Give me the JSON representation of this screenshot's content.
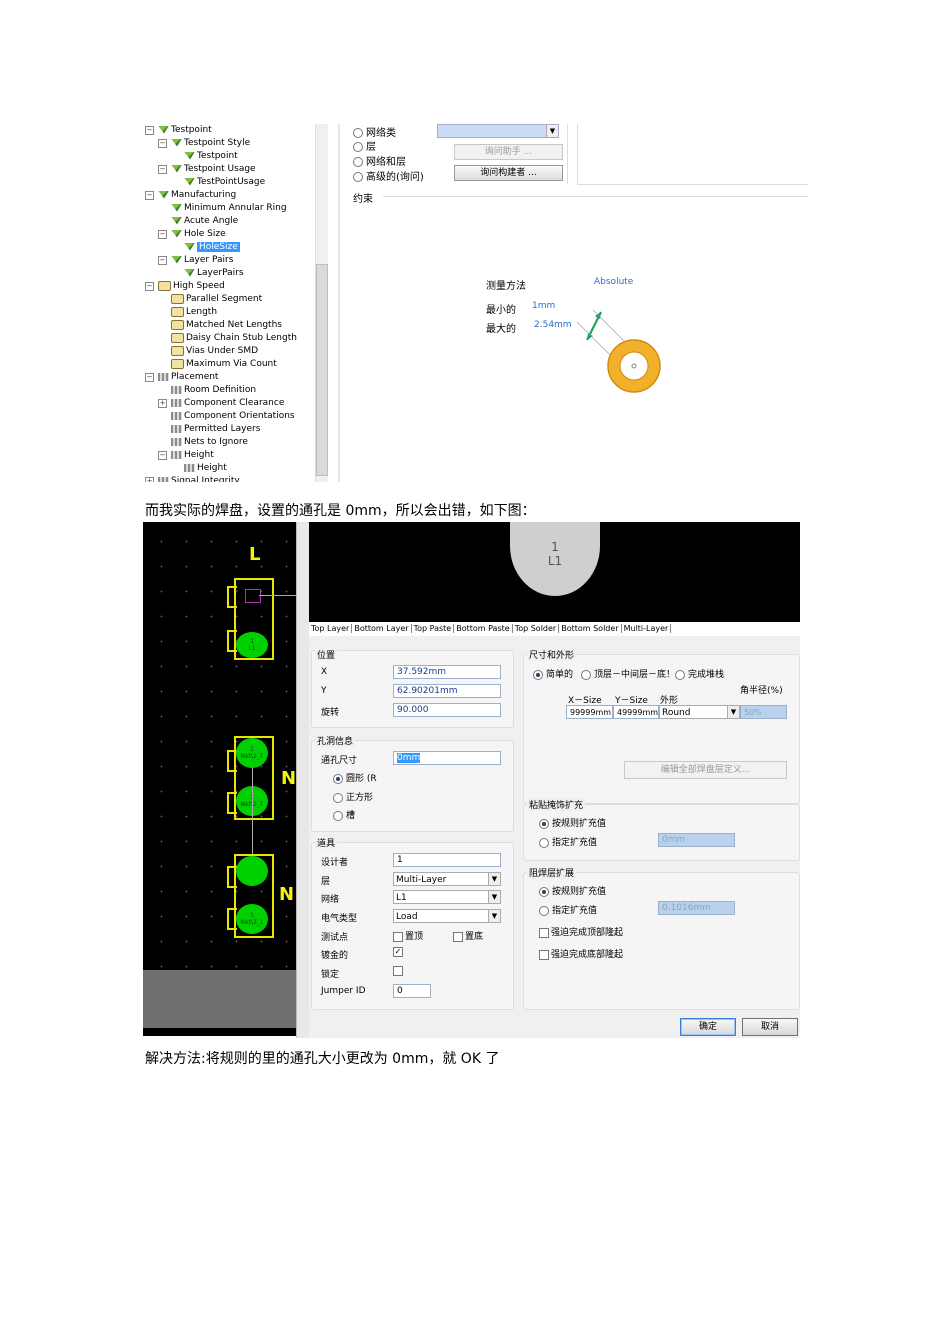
{
  "rule_tree": {
    "items": [
      {
        "label": "Testpoint",
        "icon": "testpoint-icon",
        "level": 0,
        "expander": "−",
        "selected": false
      },
      {
        "label": "Testpoint Style",
        "icon": "testpoint-icon",
        "level": 1,
        "expander": "−",
        "selected": false
      },
      {
        "label": "Testpoint",
        "icon": "testpoint-icon",
        "level": 2,
        "expander": "",
        "selected": false
      },
      {
        "label": "Testpoint Usage",
        "icon": "testpoint-icon",
        "level": 1,
        "expander": "−",
        "selected": false
      },
      {
        "label": "TestPointUsage",
        "icon": "testpoint-icon",
        "level": 2,
        "expander": "",
        "selected": false
      },
      {
        "label": "Manufacturing",
        "icon": "testpoint-icon",
        "level": 0,
        "expander": "−",
        "selected": false
      },
      {
        "label": "Minimum Annular Ring",
        "icon": "testpoint-icon",
        "level": 1,
        "expander": "",
        "selected": false
      },
      {
        "label": "Acute Angle",
        "icon": "testpoint-icon",
        "level": 1,
        "expander": "",
        "selected": false
      },
      {
        "label": "Hole Size",
        "icon": "testpoint-icon",
        "level": 1,
        "expander": "−",
        "selected": false
      },
      {
        "label": "HoleSize",
        "icon": "testpoint-icon",
        "level": 2,
        "expander": "",
        "selected": true
      },
      {
        "label": "Layer Pairs",
        "icon": "testpoint-icon",
        "level": 1,
        "expander": "−",
        "selected": false
      },
      {
        "label": "LayerPairs",
        "icon": "testpoint-icon",
        "level": 2,
        "expander": "",
        "selected": false
      },
      {
        "label": "High Speed",
        "icon": "highspeed-icon",
        "level": 0,
        "expander": "−",
        "selected": false
      },
      {
        "label": "Parallel Segment",
        "icon": "highspeed-icon",
        "level": 1,
        "expander": "",
        "selected": false
      },
      {
        "label": "Length",
        "icon": "highspeed-icon",
        "level": 1,
        "expander": "",
        "selected": false
      },
      {
        "label": "Matched Net Lengths",
        "icon": "highspeed-icon",
        "level": 1,
        "expander": "",
        "selected": false
      },
      {
        "label": "Daisy Chain Stub Length",
        "icon": "highspeed-icon",
        "level": 1,
        "expander": "",
        "selected": false
      },
      {
        "label": "Vias Under SMD",
        "icon": "highspeed-icon",
        "level": 1,
        "expander": "",
        "selected": false
      },
      {
        "label": "Maximum Via Count",
        "icon": "highspeed-icon",
        "level": 1,
        "expander": "",
        "selected": false
      },
      {
        "label": "Placement",
        "icon": "placement-icon",
        "level": 0,
        "expander": "−",
        "selected": false
      },
      {
        "label": "Room Definition",
        "icon": "placement-icon",
        "level": 1,
        "expander": "",
        "selected": false
      },
      {
        "label": "Component Clearance",
        "icon": "placement-icon",
        "level": 1,
        "expander": "+",
        "selected": false
      },
      {
        "label": "Component Orientations",
        "icon": "placement-icon",
        "level": 1,
        "expander": "",
        "selected": false
      },
      {
        "label": "Permitted Layers",
        "icon": "placement-icon",
        "level": 1,
        "expander": "",
        "selected": false
      },
      {
        "label": "Nets to Ignore",
        "icon": "placement-icon",
        "level": 1,
        "expander": "",
        "selected": false
      },
      {
        "label": "Height",
        "icon": "placement-icon",
        "level": 1,
        "expander": "−",
        "selected": false
      },
      {
        "label": "Height",
        "icon": "placement-icon",
        "level": 2,
        "expander": "",
        "selected": false
      },
      {
        "label": "Signal Integrity",
        "icon": "signal-icon",
        "level": 0,
        "expander": "+",
        "selected": false
      }
    ]
  },
  "rule_panel": {
    "scope_options": [
      "网络类",
      "层",
      "网络和层",
      "高级的(询问)"
    ],
    "query_helper": "询问助手 ...",
    "query_builder": "询问构建者 ...",
    "constraint_label": "约束",
    "measure_label": "测量方法",
    "measure_value": "Absolute",
    "min_label": "最小的",
    "min_value": "1mm",
    "max_label": "最大的",
    "max_value": "2.54mm"
  },
  "paragraph1": "而我实际的焊盘，设置的通孔是 0mm，所以会出错，如下图：",
  "pcb": {
    "letters": [
      "L",
      "N",
      "N"
    ],
    "pads": [
      {
        "num": "1",
        "net": "L1"
      },
      {
        "num": "1",
        "net": "Net\\2_1"
      },
      {
        "num": "1",
        "net": "Net\\2_1"
      },
      {
        "num": "",
        "net": ""
      },
      {
        "num": "1",
        "net": "Net\\2_1"
      }
    ]
  },
  "pad_preview": {
    "num": "1",
    "net": "L1"
  },
  "layer_tabs": [
    "Top Layer",
    "Bottom Layer",
    "Top Paste",
    "Bottom Paste",
    "Top Solder",
    "Bottom Solder",
    "Multi-Layer"
  ],
  "dialog": {
    "position": {
      "title": "位置",
      "x_label": "X",
      "x_value": "37.592mm",
      "y_label": "Y",
      "y_value": "62.90201mm",
      "rot_label": "旋转",
      "rot_value": "90.000"
    },
    "hole": {
      "title": "孔洞信息",
      "size_label": "通孔尺寸",
      "size_value": "0mm",
      "shapes": [
        "圆形 (R",
        "正方形",
        "槽"
      ]
    },
    "props": {
      "title": "道具",
      "designator_label": "设计者",
      "designator_value": "1",
      "layer_label": "层",
      "layer_value": "Multi-Layer",
      "net_label": "网络",
      "net_value": "L1",
      "etype_label": "电气类型",
      "etype_value": "Load",
      "testpoint_label": "测试点",
      "tp_top": "置顶",
      "tp_bottom": "置底",
      "plated_label": "镀金的",
      "locked_label": "锁定",
      "jumper_label": "Jumper ID",
      "jumper_value": "0"
    },
    "size_shape": {
      "title": "尺寸和外形",
      "options": [
        "简单的",
        "顶层－中间层－底！",
        "完成堆栈"
      ],
      "corner_label": "角半径(%)",
      "xsize_label": "X－Size",
      "ysize_label": "Y－Size",
      "shape_label": "外形",
      "xsize_value": "99999mm",
      "ysize_value": "49999mm",
      "shape_value": "Round",
      "corner_value": "50%",
      "edit_all": "编辑全部焊盘层定义..."
    },
    "paste": {
      "title": "粘贴掩饰扩充",
      "rule_option": "按规则扩充值",
      "spec_option": "指定扩充值",
      "spec_value": "0mm"
    },
    "solder": {
      "title": "阻焊层扩展",
      "rule_option": "按规则扩充值",
      "spec_option": "指定扩充值",
      "spec_value": "0.1016mm",
      "force_top": "强迫完成顶部隆起",
      "force_bottom": "强迫完成底部隆起"
    },
    "ok": "确定",
    "cancel": "取消"
  },
  "paragraph2": "解决方法:将规则的里的通孔大小更改为 0mm，就 OK 了",
  "colors": {
    "selection": "#3399ff",
    "pad_green": "#00d000",
    "ring_gold": "#f2b12a",
    "accent_link": "#2a6fd1"
  }
}
